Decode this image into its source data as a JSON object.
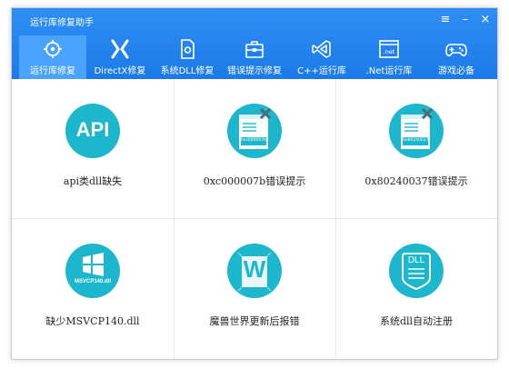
{
  "window": {
    "title": "运行库修复助手",
    "menu_icon": "≡",
    "min_icon": "–",
    "close_icon": "×"
  },
  "colors": {
    "header": "#1b7ae8",
    "active_tab": "#4aa3ff",
    "icon_teal": "#1cb7cc"
  },
  "tabs": [
    {
      "label": "运行库修复",
      "icon": "target-icon",
      "active": true
    },
    {
      "label": "DirectX修复",
      "icon": "directx-icon",
      "active": false
    },
    {
      "label": "系统DLL修复",
      "icon": "dll-file-icon",
      "active": false
    },
    {
      "label": "错误提示修复",
      "icon": "toolbox-icon",
      "active": false
    },
    {
      "label": "C++运行库",
      "icon": "visual-studio-icon",
      "active": false
    },
    {
      "label": ".Net运行库",
      "icon": "dotnet-window-icon",
      "active": false
    },
    {
      "label": "游戏必备",
      "icon": "gamepad-icon",
      "active": false
    }
  ],
  "items": [
    {
      "label": "api类dll缺失",
      "icon": "api-icon",
      "icon_text": "API"
    },
    {
      "label": "0xc000007b错误提示",
      "icon": "error-window-icon",
      "icon_text": "0xc000007b"
    },
    {
      "label": "0x80240037错误提示",
      "icon": "error-window-icon",
      "icon_text": "0x80240037"
    },
    {
      "label": "缺少MSVCP140.dll",
      "icon": "windows-logo-icon",
      "icon_text": "MSVCP140.dll"
    },
    {
      "label": "魔兽世界更新后报错",
      "icon": "wow-logo-icon",
      "icon_text": "W"
    },
    {
      "label": "系统dll自动注册",
      "icon": "dll-badge-icon",
      "icon_text": "DLL"
    }
  ]
}
